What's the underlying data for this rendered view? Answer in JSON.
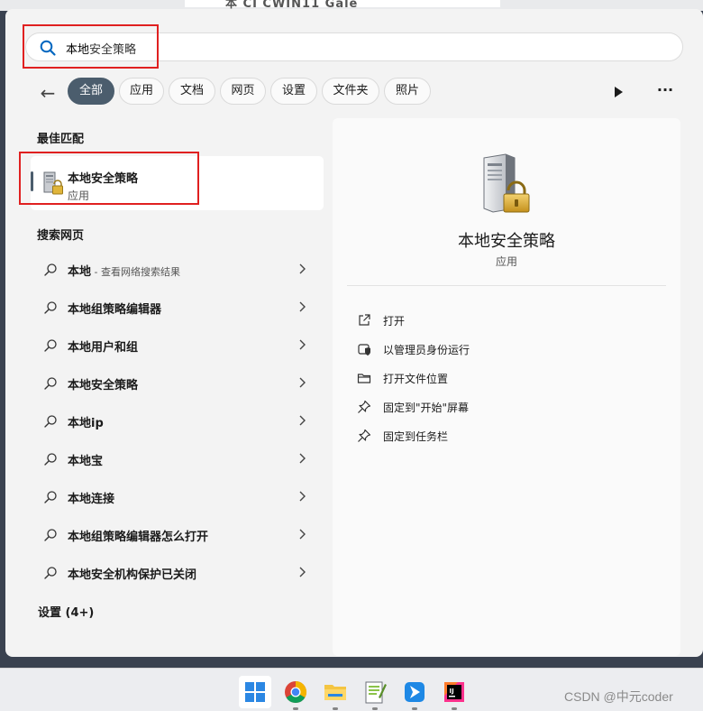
{
  "backdrop": {
    "fragment": "本 CI CWIN11 Gale"
  },
  "search": {
    "typed": "本地",
    "completion": "安全策略"
  },
  "filters": {
    "back_label": "←",
    "chips": [
      "全部",
      "应用",
      "文档",
      "网页",
      "设置",
      "文件夹",
      "照片"
    ],
    "more_label": "···"
  },
  "best_match": {
    "title": "最佳匹配",
    "name": "本地安全策略",
    "type": "应用"
  },
  "web_search": {
    "title": "搜索网页",
    "items": [
      {
        "label": "本地",
        "suffix": " - 查看网络搜索结果"
      },
      {
        "label": "本地组策略编辑器"
      },
      {
        "label": "本地用户和组"
      },
      {
        "label": "本地安全策略"
      },
      {
        "label": "本地ip"
      },
      {
        "label": "本地宝"
      },
      {
        "label": "本地连接"
      },
      {
        "label": "本地组策略编辑器怎么打开"
      },
      {
        "label": "本地安全机构保护已关闭"
      }
    ]
  },
  "settings": {
    "title": "设置 (4+)"
  },
  "detail": {
    "name": "本地安全策略",
    "type": "应用",
    "actions": [
      {
        "label": "打开",
        "icon": "open-external-icon"
      },
      {
        "label": "以管理员身份运行",
        "icon": "shield-admin-icon"
      },
      {
        "label": "打开文件位置",
        "icon": "folder-icon"
      },
      {
        "label": "固定到\"开始\"屏幕",
        "icon": "pin-icon"
      },
      {
        "label": "固定到任务栏",
        "icon": "pin-icon"
      }
    ]
  },
  "taskbar": {
    "apps": [
      "windows-start-icon",
      "chrome-icon",
      "file-explorer-icon",
      "notepad-plus-icon",
      "tencent-app-icon",
      "intellij-icon"
    ]
  },
  "watermark": "CSDN @中元coder",
  "colors": {
    "accent": "#4b5d6d",
    "highlight": "#e02020",
    "search_icon": "#0067c0"
  }
}
